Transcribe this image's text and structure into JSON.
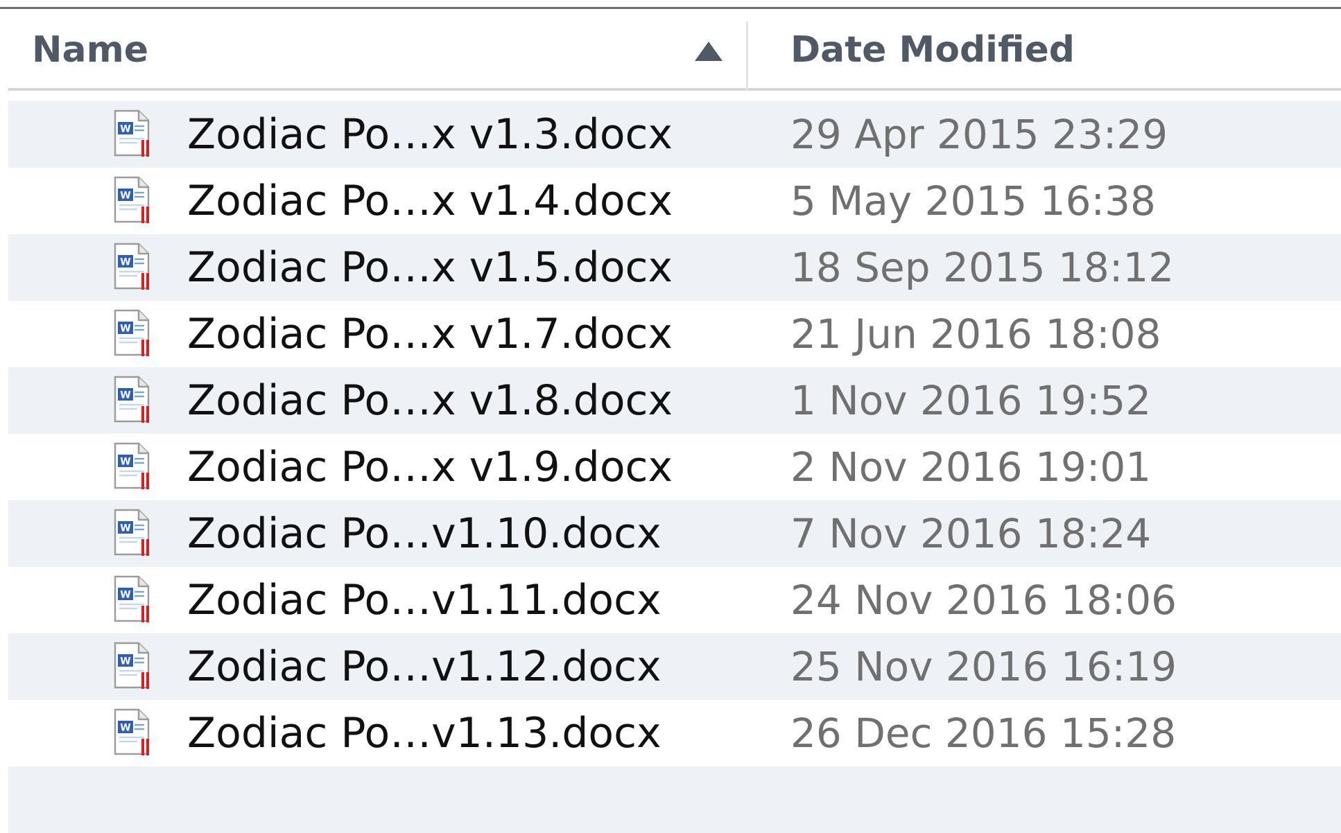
{
  "header": {
    "name_label": "Name",
    "date_label": "Date Modified",
    "sort_direction": "ascending"
  },
  "files": [
    {
      "name": "Zodiac Po…x v1.3.docx",
      "modified": "29 Apr 2015 23:29",
      "icon": "word-document-icon"
    },
    {
      "name": "Zodiac Po…x v1.4.docx",
      "modified": "5 May 2015 16:38",
      "icon": "word-document-icon"
    },
    {
      "name": "Zodiac Po…x v1.5.docx",
      "modified": "18 Sep 2015 18:12",
      "icon": "word-document-icon"
    },
    {
      "name": "Zodiac Po…x v1.7.docx",
      "modified": "21 Jun 2016 18:08",
      "icon": "word-document-icon"
    },
    {
      "name": "Zodiac Po…x v1.8.docx",
      "modified": "1 Nov 2016 19:52",
      "icon": "word-document-icon"
    },
    {
      "name": "Zodiac Po…x v1.9.docx",
      "modified": "2 Nov 2016 19:01",
      "icon": "word-document-icon"
    },
    {
      "name": "Zodiac Po…v1.10.docx",
      "modified": "7 Nov 2016 18:24",
      "icon": "word-document-icon"
    },
    {
      "name": "Zodiac Po…v1.11.docx",
      "modified": "24 Nov 2016 18:06",
      "icon": "word-document-icon"
    },
    {
      "name": "Zodiac Po…v1.12.docx",
      "modified": "25 Nov 2016 16:19",
      "icon": "word-document-icon"
    },
    {
      "name": "Zodiac Po…v1.13.docx",
      "modified": "26 Dec 2016 15:28",
      "icon": "word-document-icon"
    }
  ],
  "colors": {
    "header_text": "#505a66",
    "row_alt": "#eef2f7",
    "date_text": "#707070",
    "name_text": "#111111"
  }
}
